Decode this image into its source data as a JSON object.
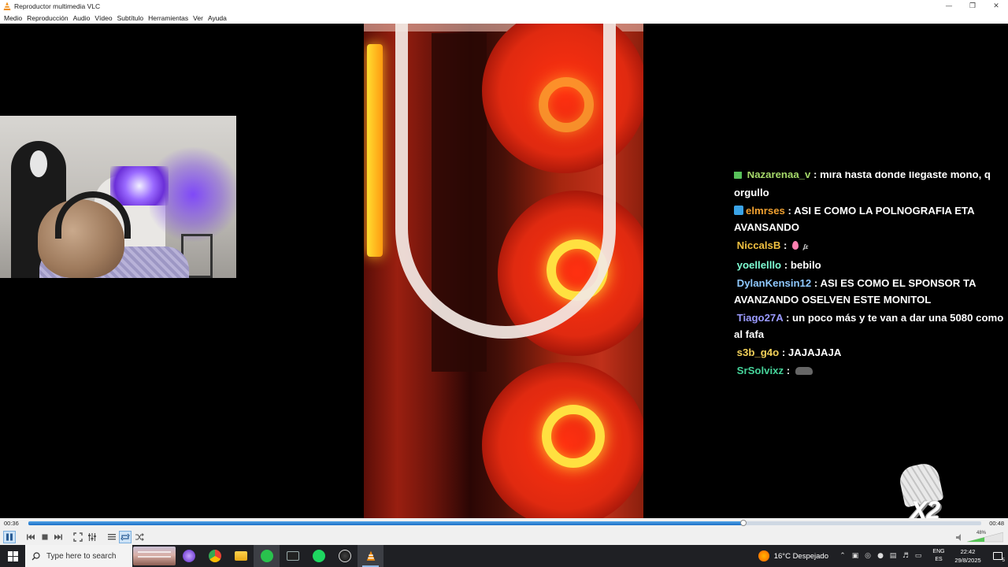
{
  "window": {
    "title": "Reproductor multimedia VLC"
  },
  "menu": [
    "Medio",
    "Reproducción",
    "Audio",
    "Vídeo",
    "Subtítulo",
    "Herramientas",
    "Ver",
    "Ayuda"
  ],
  "chat": [
    {
      "user": "Nazarenaa_v",
      "text": "mira hasta donde llegaste mono, q",
      "color": "#a6d96a",
      "badge": "#58c15a",
      "cut": true
    },
    {
      "user": "",
      "text": "orgullo",
      "color": "#ffffff"
    },
    {
      "user": "elmrses",
      "text": "ASI E COMO LA POLNOGRAFIA ETA AVANSANDO",
      "color": "#f0a030",
      "badge": "#3aa3e6"
    },
    {
      "user": "NiccalsB",
      "text": "",
      "color": "#f0c040",
      "emote": "drop-small"
    },
    {
      "user": "yoellelllo",
      "text": "bebilo",
      "color": "#7fffd4"
    },
    {
      "user": "DylanKensin12",
      "text": "ASI ES COMO EL SPONSOR TA AVANZANDO OSELVEN ESTE MONITOL",
      "color": "#8ec8ff"
    },
    {
      "user": "Tiago27A",
      "text": "un poco más y te van a dar una 5080 como al fafa",
      "color": "#9b9bff"
    },
    {
      "user": "s3b_g4o",
      "text": "JAJAJAJA",
      "color": "#f2d15a"
    },
    {
      "user": "SrSolvixz",
      "text": "",
      "color": "#46d39a",
      "emote": "car"
    }
  ],
  "overlay": {
    "multiplier": "X2"
  },
  "player": {
    "current_time": "00:36",
    "total_time": "00:48",
    "progress": 0.75,
    "volume_label": "48%",
    "volume_level": 0.48,
    "accent": "#1c6fc7"
  },
  "controls": {
    "play_pause": "pause-icon",
    "previous": "previous-icon",
    "stop": "stop-icon",
    "next": "next-icon",
    "fullscreen": "fullscreen-icon",
    "extended": "extended-settings-icon",
    "playlist": "playlist-icon",
    "loop": "loop-icon",
    "random": "random-icon"
  },
  "taskbar": {
    "search_placeholder": "Type here to search",
    "weather": "16°C  Despejado",
    "lang_top": "ENG",
    "lang_bottom": "ES",
    "clock_time": "22:42",
    "clock_date": "29/8/2025",
    "notifications": "5"
  }
}
